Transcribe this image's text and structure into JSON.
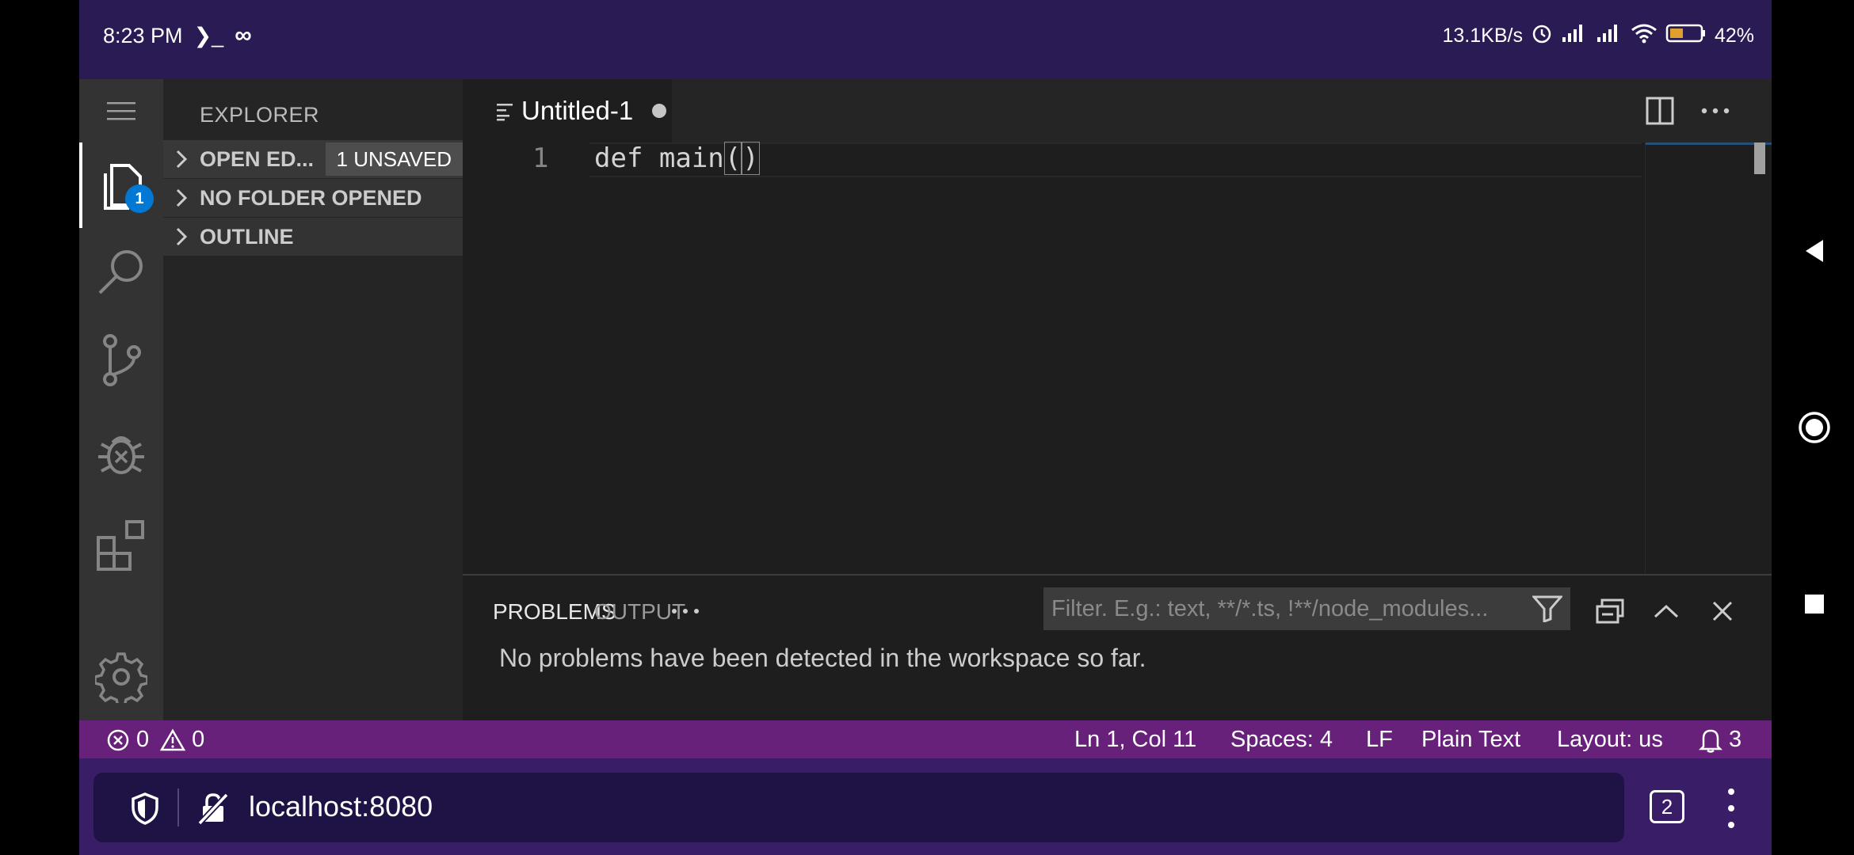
{
  "status_bar": {
    "time": "8:23 PM",
    "terminal_glyph": "❯_",
    "infinity_glyph": "∞",
    "net_speed": "13.1KB/s",
    "battery": "42%"
  },
  "sidebar": {
    "title": "EXPLORER",
    "sections": [
      {
        "label": "OPEN ED...",
        "badge": "1 UNSAVED"
      },
      {
        "label": "NO FOLDER OPENED"
      },
      {
        "label": "OUTLINE"
      }
    ]
  },
  "activity_bar": {
    "explorer_badge": "1"
  },
  "editor": {
    "tab_label": "Untitled-1",
    "line_number": "1",
    "code_before": "def main",
    "code_open": "(",
    "code_close": ")"
  },
  "panel": {
    "tab_problems": "PROBLEMS",
    "tab_output": "OUTPUT",
    "filter_placeholder": "Filter. E.g.: text, **/*.ts, !**/node_modules...",
    "message": "No problems have been detected in the workspace so far."
  },
  "status_strip": {
    "errors": "0",
    "warnings": "0",
    "cursor": "Ln 1, Col 11",
    "spaces": "Spaces: 4",
    "eol": "LF",
    "language": "Plain Text",
    "layout": "Layout: us",
    "notifications": "3"
  },
  "browser": {
    "url": "localhost:8080",
    "tab_count": "2"
  },
  "colors": {
    "status_strip": "#68217a",
    "browser_bar": "#3a1d67",
    "phone_status": "#2a1b55",
    "activity_bar": "#333333",
    "accent_badge": "#0078d4"
  }
}
